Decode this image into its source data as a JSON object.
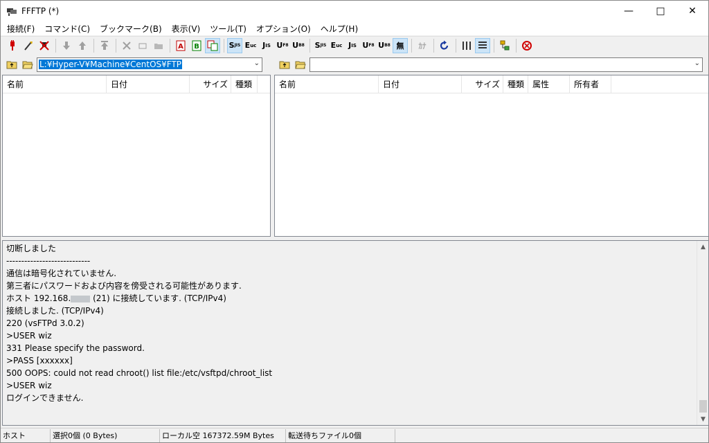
{
  "window": {
    "title": "FFFTP (*)"
  },
  "menu": [
    "接続(F)",
    "コマンド(C)",
    "ブックマーク(B)",
    "表示(V)",
    "ツール(T)",
    "オプション(O)",
    "ヘルプ(H)"
  ],
  "toolbar": {
    "connect_icon": "connect-icon",
    "quick_connect_icon": "quick-connect-icon",
    "disconnect_icon": "disconnect-icon",
    "text_buttons": {
      "mode_a": "A",
      "mode_b": "B",
      "sjis": "S",
      "euc": "E",
      "jis": "J",
      "utf8": "U",
      "utf8b": "U",
      "none": "無",
      "kana": "ｶﾅ"
    },
    "sub_labels": {
      "sjis": "JIS",
      "euc": "uc",
      "jis": "IS",
      "utf8": "F8",
      "utf8b": "B8"
    }
  },
  "local_path": {
    "value": "L:¥Hyper-V¥Machine¥CentOS¥FTP"
  },
  "remote_path": {
    "value": ""
  },
  "local_columns": [
    "名前",
    "日付",
    "サイズ",
    "種類"
  ],
  "remote_columns": [
    "名前",
    "日付",
    "サイズ",
    "種類",
    "属性",
    "所有者"
  ],
  "log": {
    "lines": [
      "切断しました",
      "----------------------------",
      "通信は暗号化されていません.",
      "第三者にパスワードおよび内容を傍受される可能性があります.",
      "ホスト 192.168.",
      "接続しました. (TCP/IPv4)",
      "220 (vsFTPd 3.0.2)",
      ">USER wiz",
      "331 Please specify the password.",
      ">PASS [xxxxxx]",
      "500 OOPS: could not read chroot() list file:/etc/vsftpd/chroot_list",
      ">USER wiz",
      "ログインできません."
    ],
    "host_suffix": " (21) に接続しています. (TCP/IPv4)"
  },
  "status": {
    "host": "ホスト",
    "selection": "選択0個  (0 Bytes)",
    "local_free": "ローカル空 167372.59M Bytes",
    "queue": "転送待ちファイル0個"
  }
}
